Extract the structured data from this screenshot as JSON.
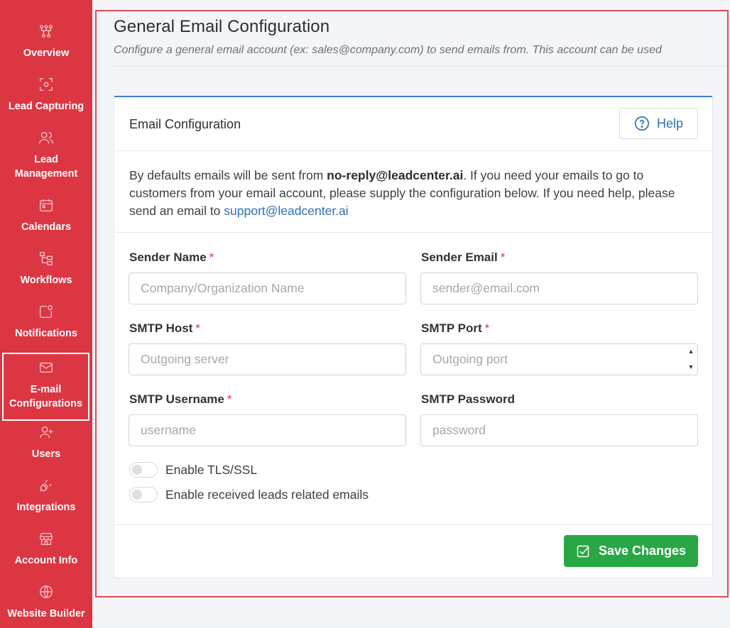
{
  "sidebar": {
    "items": [
      {
        "label": "Overview",
        "icon": "flow-chart-icon"
      },
      {
        "label": "Lead Capturing",
        "icon": "capture-target-icon"
      },
      {
        "label": "Lead\nManagement",
        "icon": "users-icon"
      },
      {
        "label": "Calendars",
        "icon": "calendar-icon"
      },
      {
        "label": "Workflows",
        "icon": "workflow-icon"
      },
      {
        "label": "Notifications",
        "icon": "notification-icon"
      },
      {
        "label": "E-mail\nConfigurations",
        "icon": "mail-icon",
        "active": true
      },
      {
        "label": "Users",
        "icon": "user-plus-icon"
      },
      {
        "label": "Integrations",
        "icon": "plug-icon"
      },
      {
        "label": "Account Info",
        "icon": "store-icon"
      },
      {
        "label": "Website Builder",
        "icon": "globe-icon"
      }
    ]
  },
  "page": {
    "title": "General Email Configuration",
    "subtitle": "Configure a general email account (ex: sales@company.com) to send emails from. This account can be used"
  },
  "card": {
    "title": "Email Configuration",
    "help_label": "Help",
    "info_prefix": "By defaults emails will be sent from ",
    "info_email": "no-reply@leadcenter.ai",
    "info_middle": ". If you need your emails to go to customers from your email account, please supply the configuration below. If you need help, please send an email to ",
    "info_support": "support@leadcenter.ai"
  },
  "form": {
    "sender_name": {
      "label": "Sender Name",
      "required": "*",
      "placeholder": "Company/Organization Name",
      "value": ""
    },
    "sender_email": {
      "label": "Sender Email",
      "required": "*",
      "placeholder": "sender@email.com",
      "value": ""
    },
    "smtp_host": {
      "label": "SMTP Host",
      "required": "*",
      "placeholder": "Outgoing server",
      "value": ""
    },
    "smtp_port": {
      "label": "SMTP Port",
      "required": "*",
      "placeholder": "Outgoing port",
      "value": ""
    },
    "smtp_username": {
      "label": "SMTP Username",
      "required": "*",
      "placeholder": "username",
      "value": ""
    },
    "smtp_password": {
      "label": "SMTP Password",
      "placeholder": "password",
      "value": ""
    },
    "toggle_tls": {
      "label": "Enable TLS/SSL",
      "on": false
    },
    "toggle_leads": {
      "label": "Enable received leads related emails",
      "on": false
    },
    "save_label": "Save Changes"
  },
  "colors": {
    "sidebar_bg": "#dc3643",
    "accent_blue": "#3f7fc8",
    "save_green": "#29a745",
    "required_red": "#dc3643"
  }
}
